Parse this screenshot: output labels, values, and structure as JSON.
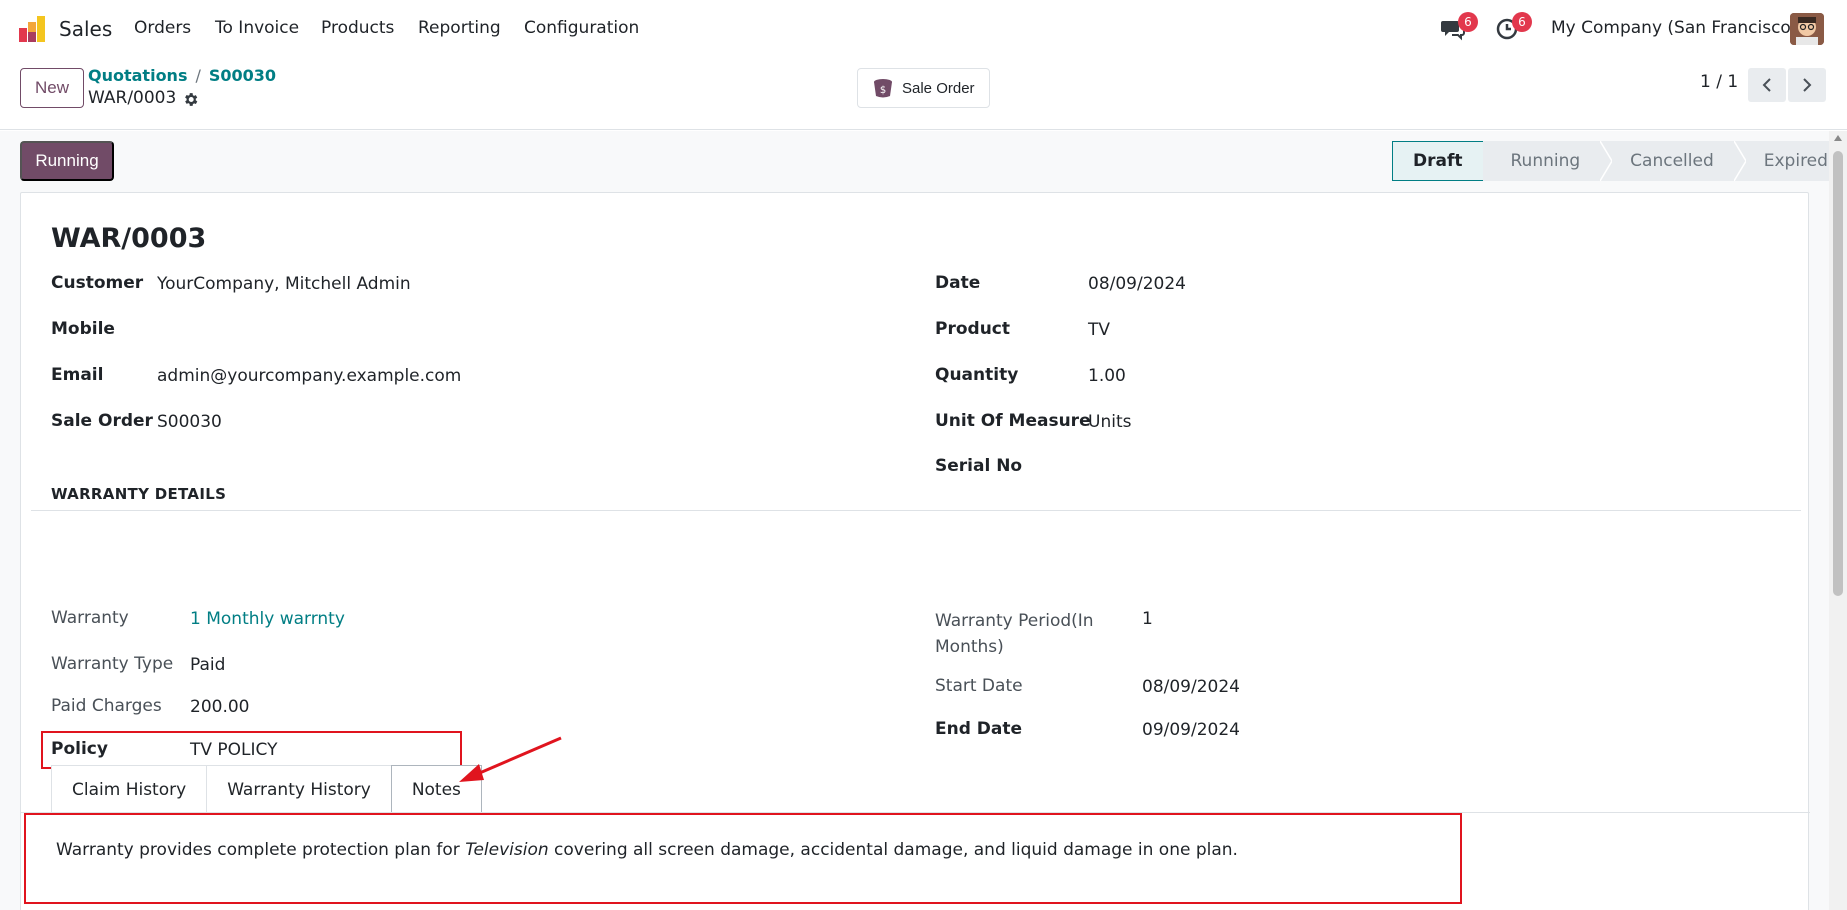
{
  "topnav": {
    "app_name": "Sales",
    "menu": [
      "Orders",
      "To Invoice",
      "Products",
      "Reporting",
      "Configuration"
    ],
    "messages_count": "6",
    "activities_count": "6",
    "company": "My Company (San Francisco)"
  },
  "control": {
    "new_label": "New",
    "breadcrumb_parent": "Quotations",
    "breadcrumb_sep": "/",
    "breadcrumb_current": "S00030",
    "record_name": "WAR/0003",
    "smart_button": "Sale Order",
    "pager": "1 / 1"
  },
  "status": {
    "button": "Running",
    "stages": [
      "Draft",
      "Running",
      "Cancelled",
      "Expired"
    ],
    "active_stage": "Draft"
  },
  "form": {
    "title": "WAR/0003",
    "left": [
      {
        "label": "Customer",
        "value": "YourCompany, Mitchell Admin"
      },
      {
        "label": "Mobile",
        "value": ""
      },
      {
        "label": "Email",
        "value": "admin@yourcompany.example.com"
      },
      {
        "label": "Sale Order",
        "value": "S00030"
      }
    ],
    "right": [
      {
        "label": "Date",
        "value": "08/09/2024"
      },
      {
        "label": "Product",
        "value": "TV"
      },
      {
        "label": "Quantity",
        "value": "1.00"
      },
      {
        "label": "Unit Of Measure",
        "value": "Units"
      },
      {
        "label": "Serial No",
        "value": ""
      }
    ],
    "section_title": "WARRANTY DETAILS",
    "warranty_left": [
      {
        "label": "Warranty",
        "value": "1 Monthly warrnty"
      },
      {
        "label": "Warranty Type",
        "value": "Paid"
      },
      {
        "label": "Paid Charges",
        "value": "200.00"
      },
      {
        "label": "Policy",
        "value": "TV POLICY"
      }
    ],
    "warranty_right": [
      {
        "label": "Warranty Period(In",
        "label2": "Months)",
        "value": "1"
      },
      {
        "label": "Start Date",
        "value": "08/09/2024"
      },
      {
        "label": "End Date",
        "value": "09/09/2024"
      }
    ],
    "tabs": [
      "Claim History",
      "Warranty History",
      "Notes"
    ],
    "active_tab": "Notes",
    "notes": {
      "before": "Warranty provides complete protection plan for ",
      "italic": "Television",
      "after": " covering all screen damage, accidental damage, and liquid damage in one plan."
    }
  },
  "colors": {
    "brand": "#714b67",
    "link": "#017e84",
    "badge": "#e2384d",
    "highlight": "#e0141e"
  }
}
